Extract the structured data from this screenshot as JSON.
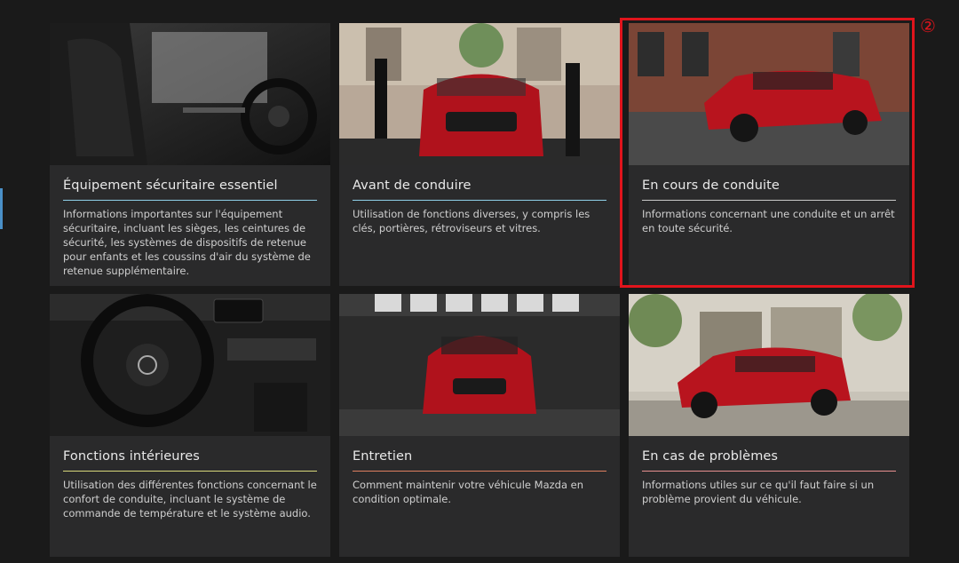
{
  "cards": [
    {
      "title": "Équipement sécuritaire essentiel",
      "description": "Informations importantes sur l'équipement sécuritaire, incluant les sièges, les ceintures de sécurité, les systèmes de dispositifs de retenue pour enfants et les coussins d'air du système de retenue supplémentaire.",
      "accent": "#8fd0e8"
    },
    {
      "title": "Avant de conduire",
      "description": "Utilisation de fonctions diverses, y compris les clés, portières, rétroviseurs et vitres.",
      "accent": "#8fd0e8"
    },
    {
      "title": "En cours de conduite",
      "description": "Informations concernant une conduite et un arrêt en toute sécurité.",
      "accent": "#c9c9c9"
    },
    {
      "title": "Fonctions intérieures",
      "description": "Utilisation des différentes fonctions concernant le confort de conduite, incluant le système de commande de température et le système audio.",
      "accent": "#d8d87a"
    },
    {
      "title": "Entretien",
      "description": "Comment maintenir votre véhicule Mazda en condition optimale.",
      "accent": "#e08060"
    },
    {
      "title": "En cas de problèmes",
      "description": "Informations utiles sur ce qu'il faut faire si un problème provient du véhicule.",
      "accent": "#e89090"
    }
  ],
  "annotation": {
    "marker": "②",
    "color": "#e0141c"
  }
}
